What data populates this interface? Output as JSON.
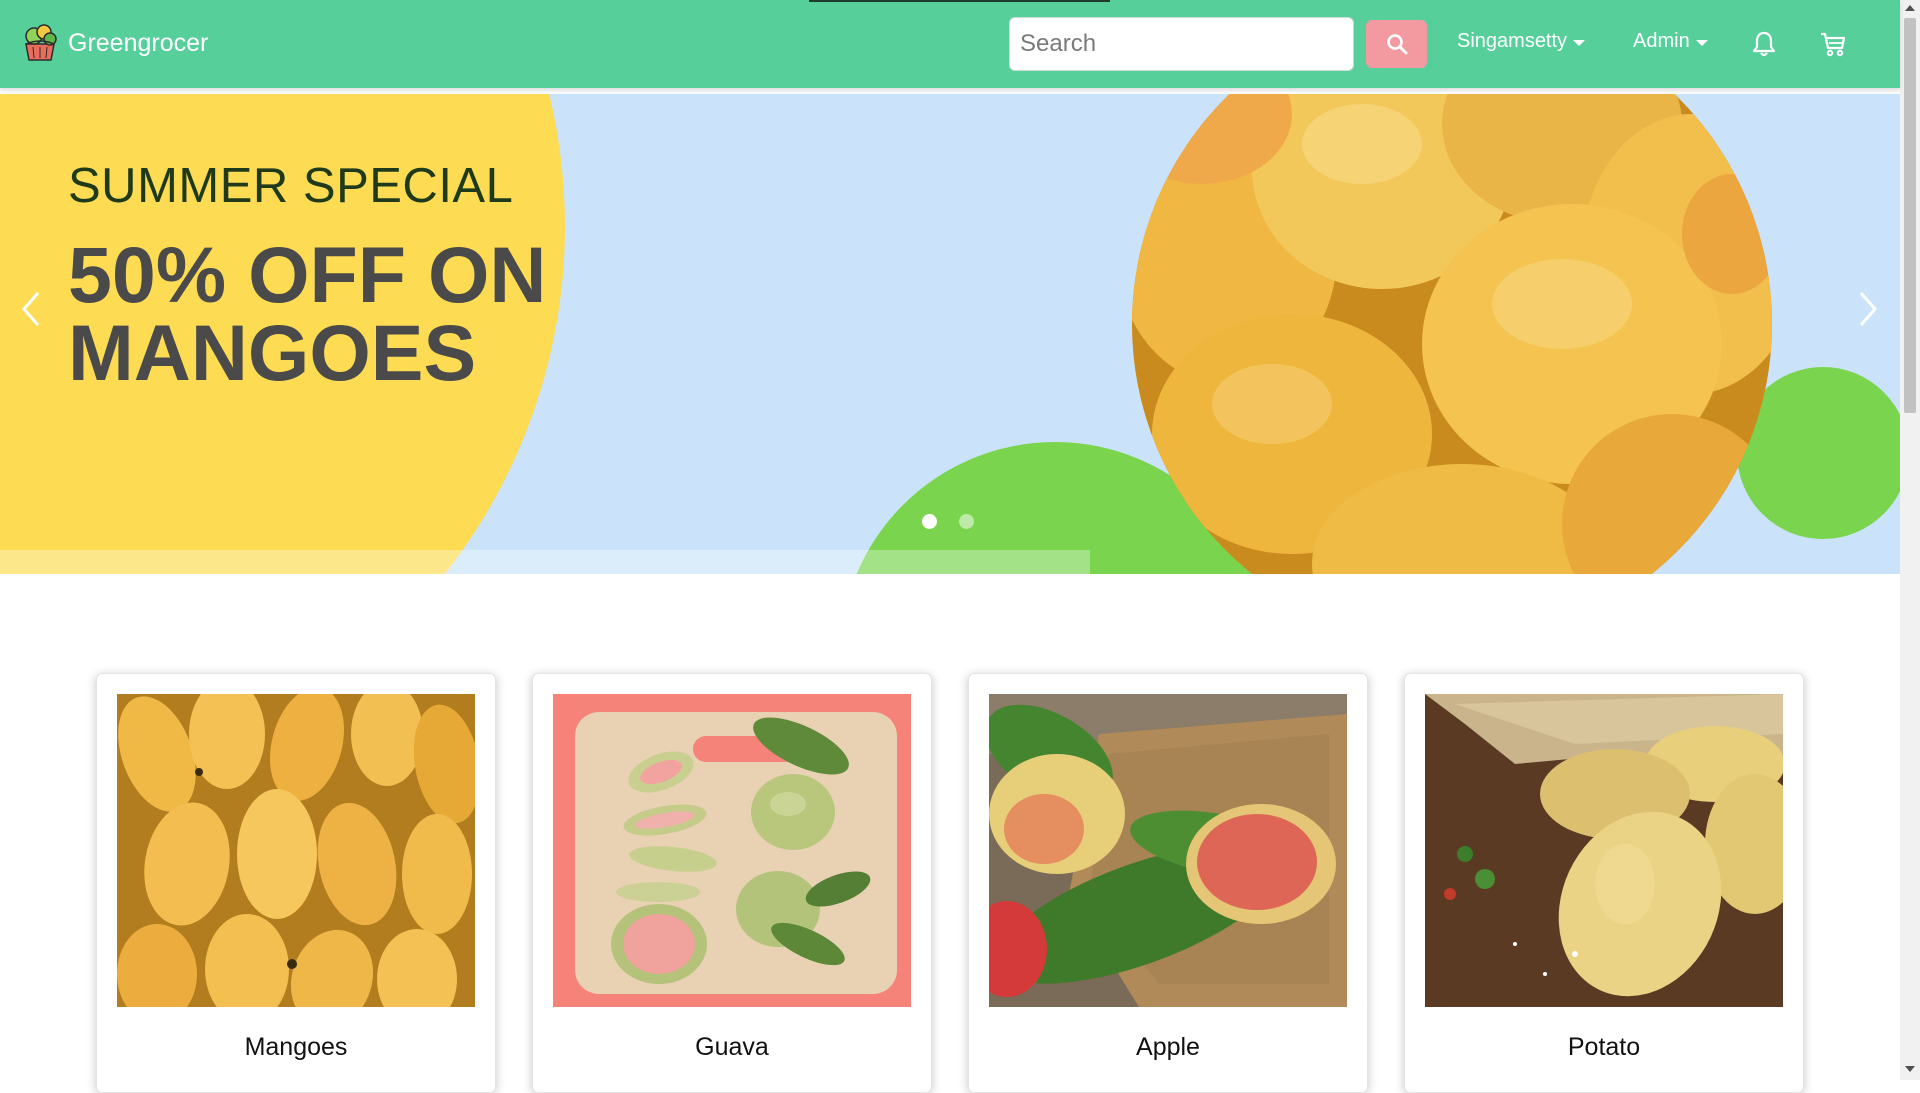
{
  "navbar": {
    "brand": "Greengrocer",
    "search_placeholder": "Search",
    "user_menu": "Singamsetty",
    "admin_menu": "Admin",
    "icons": [
      "logo-icon",
      "search-icon",
      "bell-icon",
      "cart-icon"
    ]
  },
  "banner": {
    "kicker": "SUMMER SPECIAL",
    "headline": "50% OFF ON MANGOES",
    "slides": 2,
    "active_slide": 1
  },
  "products": [
    {
      "name": "Mangoes"
    },
    {
      "name": "Guava"
    },
    {
      "name": "Apple"
    },
    {
      "name": "Potato"
    }
  ],
  "colors": {
    "navbar": "#57cf9b",
    "search_button": "#f39aa0",
    "banner_bg": "#cae3fa",
    "banner_yellow": "#fddc54",
    "banner_green": "#7ad44e"
  }
}
